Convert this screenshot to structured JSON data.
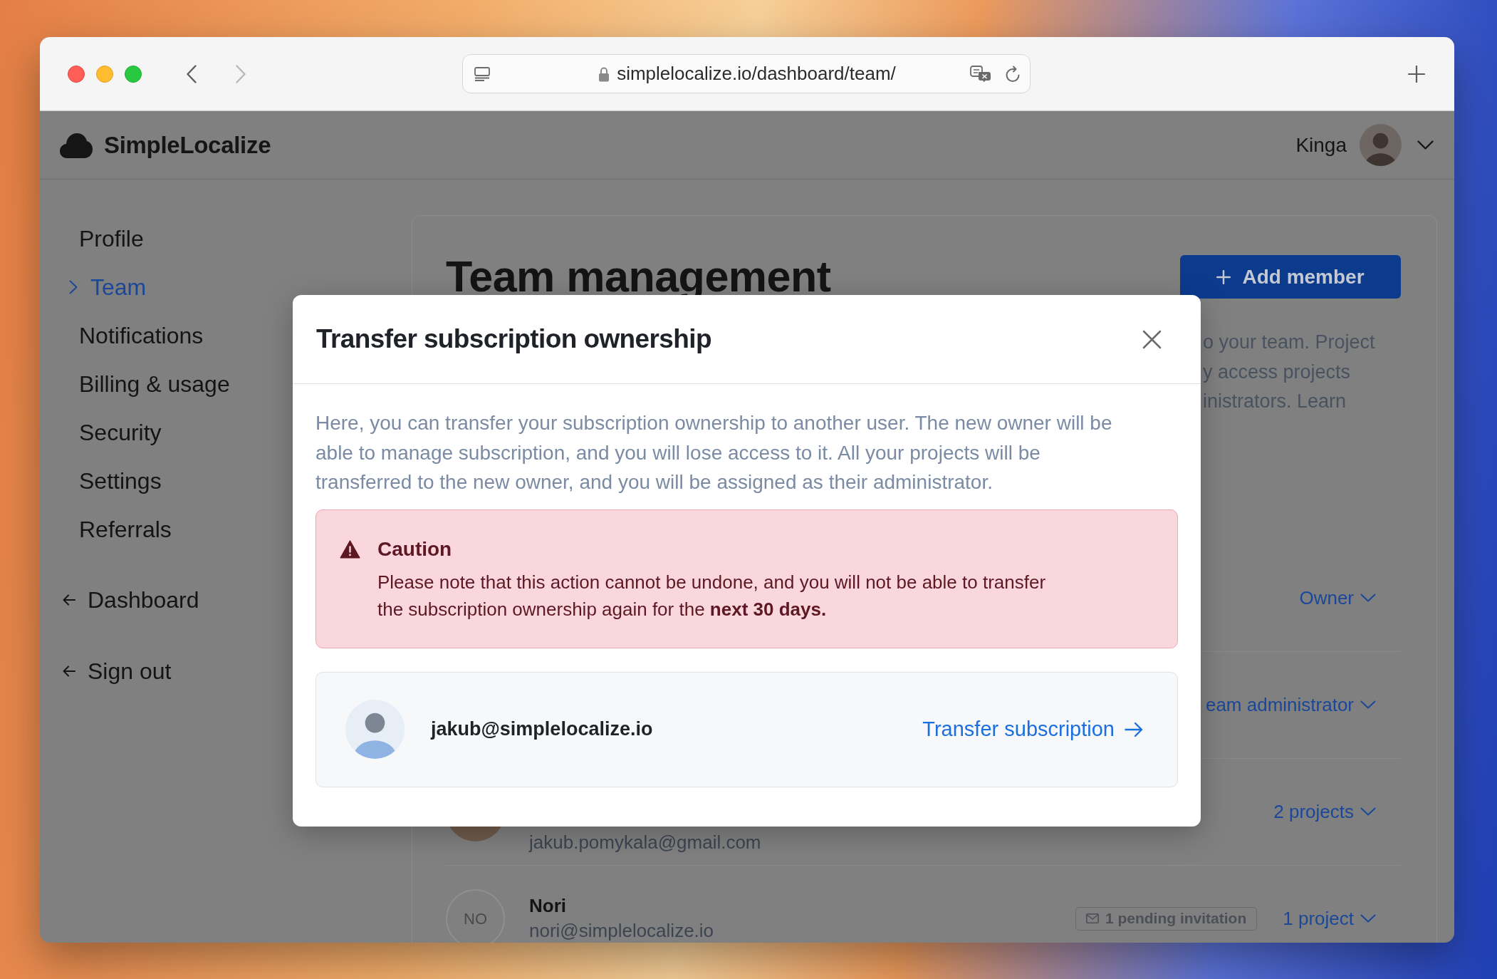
{
  "browser": {
    "address": "simplelocalize.io/dashboard/team/",
    "back_enabled": true,
    "forward_enabled": false
  },
  "header": {
    "brand": "SimpleLocalize",
    "user": "Kinga"
  },
  "sidebar": {
    "items": [
      {
        "label": "Profile",
        "selected": false
      },
      {
        "label": "Team",
        "selected": true
      },
      {
        "label": "Notifications",
        "selected": false
      },
      {
        "label": "Billing & usage",
        "selected": false
      },
      {
        "label": "Security",
        "selected": false
      },
      {
        "label": "Settings",
        "selected": false
      },
      {
        "label": "Referrals",
        "selected": false
      }
    ],
    "links": [
      {
        "label": "Dashboard"
      },
      {
        "label": "Sign out"
      }
    ]
  },
  "page": {
    "title": "Team management",
    "add_button": "Add member",
    "description_lines": [
      "o your team. Project",
      "y access projects",
      "inistrators. Learn"
    ],
    "members": [
      {
        "role": "Owner"
      },
      {
        "role": "eam administrator"
      },
      {
        "avatar": {
          "kind": "photo"
        },
        "email": "jakub.pomykala@gmail.com",
        "role": "2 projects"
      },
      {
        "avatar": {
          "kind": "initials",
          "text": "NO"
        },
        "name": "Nori",
        "email": "nori@simplelocalize.io",
        "badge": "1 pending invitation",
        "role": "1 project"
      }
    ]
  },
  "modal": {
    "title": "Transfer subscription ownership",
    "text": "Here, you can transfer your subscription ownership to another user. The new owner will be able to manage subscription, and you will lose access to it. All your projects will be transferred to the new owner, and you will be assigned as their administrator.",
    "caution": {
      "title": "Caution",
      "text": "Please note that this action cannot be undone, and you will not be able to transfer the subscription ownership again for the **next 30 days.**"
    },
    "candidate": {
      "email": "jakub@simplelocalize.io",
      "action": "Transfer subscription"
    }
  }
}
